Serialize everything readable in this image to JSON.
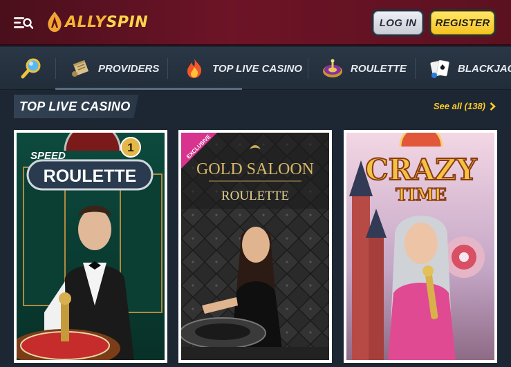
{
  "header": {
    "logo_part1": "ALLY",
    "logo_part2": "SPIN",
    "login_label": "LOG IN",
    "register_label": "REGISTER"
  },
  "nav": {
    "items": [
      {
        "label": "",
        "icon": "search-icon"
      },
      {
        "label": "PROVIDERS",
        "icon": "scroll-icon"
      },
      {
        "label": "TOP LIVE CASINO",
        "icon": "flame-icon"
      },
      {
        "label": "ROULETTE",
        "icon": "roulette-icon"
      },
      {
        "label": "BLACKJACK",
        "icon": "cards-icon"
      }
    ]
  },
  "section": {
    "title": "TOP LIVE CASINO",
    "see_all": "See all (138)"
  },
  "games": [
    {
      "title_top": "SPEED",
      "title_main": "ROULETTE",
      "badge": "1"
    },
    {
      "ribbon": "EXCLUSIVE",
      "title_top": "GOLD SALOON",
      "title_main": "ROULETTE"
    },
    {
      "title_top": "CRAZY",
      "title_main": "TIME"
    }
  ],
  "colors": {
    "header_bg": "#6d1427",
    "accent_yellow": "#ffcc2a",
    "nav_bg": "#263241"
  }
}
